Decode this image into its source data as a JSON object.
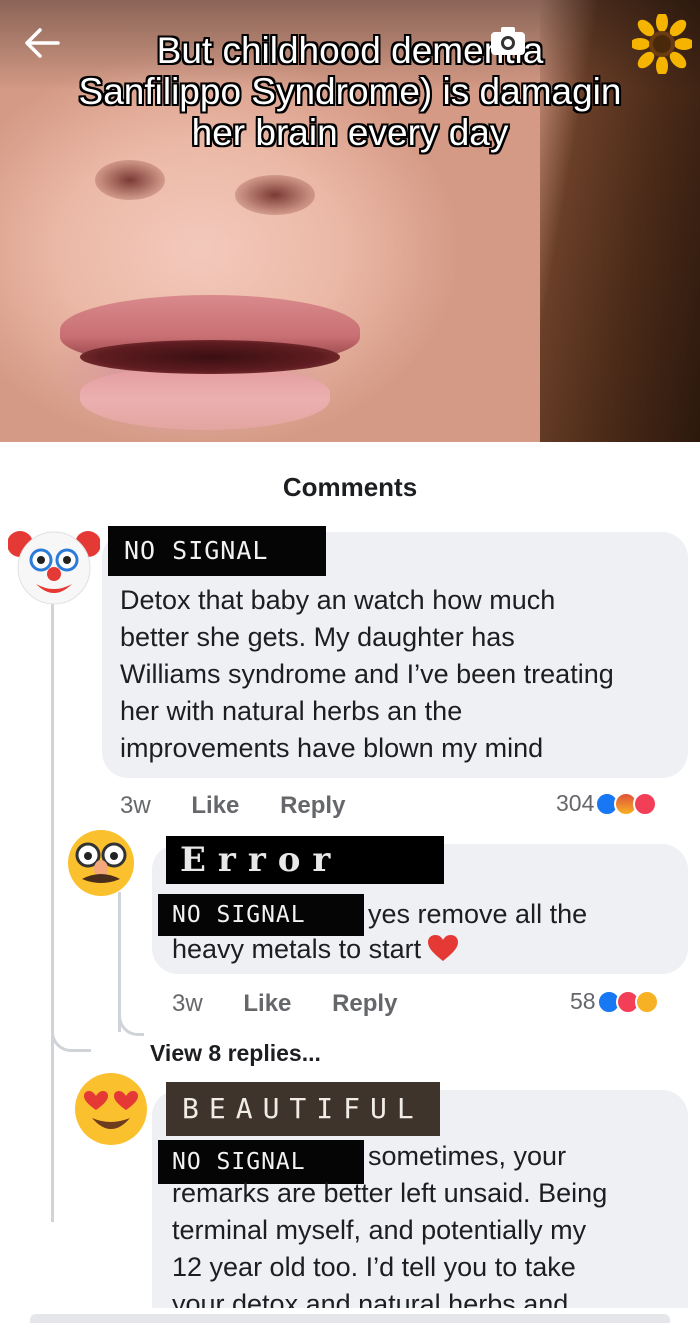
{
  "header": {
    "caption_lines": [
      "But childhood dementia",
      "Sanfilippo Syndrome) is damagin",
      "her brain every day"
    ],
    "icons": [
      "back-arrow-icon",
      "camera-icon",
      "sunflower-icon"
    ]
  },
  "comments_sheet": {
    "title": "Comments",
    "comments": [
      {
        "author_redaction": "NO SIGNAL",
        "text": "Detox that baby an watch how much better she gets. My daughter has Williams syndrome and I’ve been treating her with natural herbs an the improvements have blown my mind",
        "text_lines": [
          "Detox that baby an watch how much",
          "better she gets. My daughter has",
          "Williams syndrome and I’ve been treating",
          "her with natural herbs an the",
          "improvements have blown my mind"
        ],
        "time": "3w",
        "like_label": "Like",
        "reply_label": "Reply",
        "reaction_count": "304",
        "reaction_icons": [
          "like",
          "angry",
          "love"
        ],
        "avatar": "clown-emoji"
      },
      {
        "author_redaction": "Error",
        "mention_redaction": "NO SIGNAL",
        "text_line1": "yes remove all the",
        "text_line2": "heavy metals to start",
        "trailing_emoji": "red-heart",
        "time": "3w",
        "like_label": "Like",
        "reply_label": "Reply",
        "reaction_count": "58",
        "reaction_icons": [
          "like",
          "love",
          "care"
        ],
        "avatar": "disguised-face-emoji"
      },
      {
        "author_redaction": "BEAUTIFUL",
        "mention_redaction": "NO SIGNAL",
        "text_line1": "sometimes, your",
        "text_lines": [
          "remarks are better left unsaid. Being",
          "terminal myself, and potentially my",
          "12 year old too. I’d tell you to take",
          "your detox and natural herbs and"
        ],
        "avatar": "heart-eyes-emoji"
      }
    ],
    "view_replies_label": "View 8 replies..."
  }
}
